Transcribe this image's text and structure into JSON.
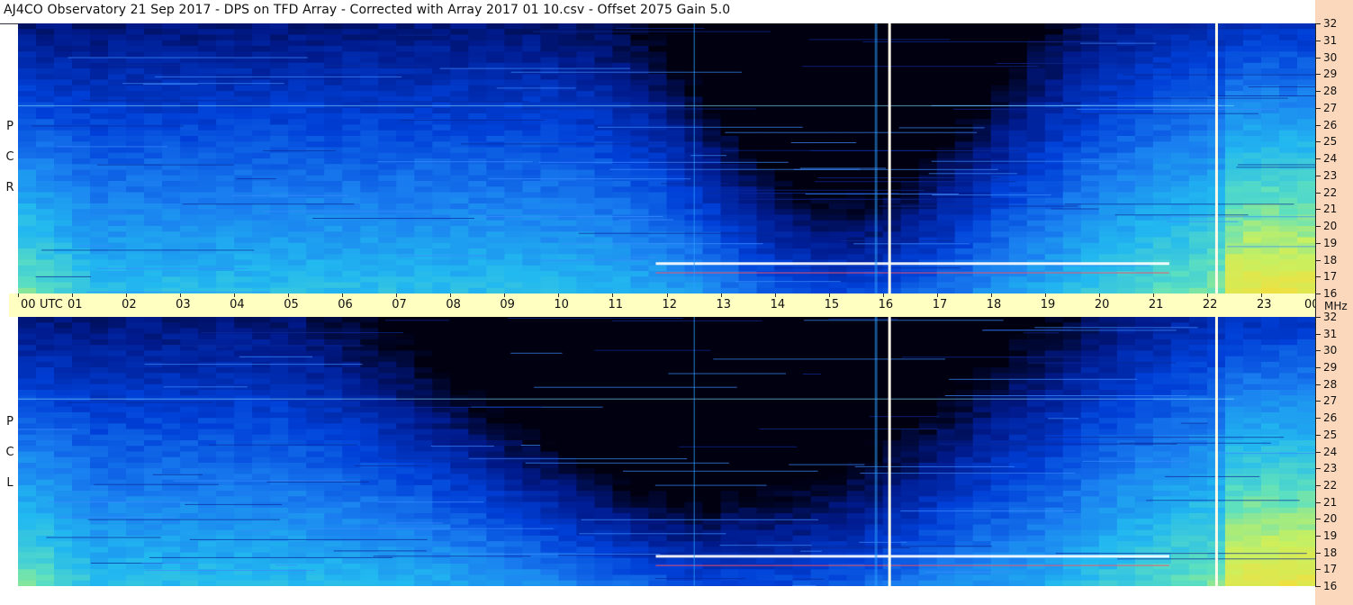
{
  "title": "AJ4CO Observatory  21 Sep 2017  -  DPS on TFD Array  -  Corrected with Array 2017 01 10.csv  -  Offset 2075  Gain 5.0",
  "panels": [
    {
      "id": "rcp",
      "label": [
        "R",
        "C",
        "P"
      ]
    },
    {
      "id": "lcp",
      "label": [
        "L",
        "C",
        "P"
      ]
    }
  ],
  "chart_data": {
    "type": "heatmap",
    "title": "AJ4CO Observatory  21 Sep 2017  -  DPS on TFD Array  -  Corrected with Array 2017 01 10.csv  -  Offset 2075  Gain 5.0",
    "x_unit_label": "UTC",
    "y_unit_label": "MHz",
    "x_ticks": [
      "00",
      "01",
      "02",
      "03",
      "04",
      "05",
      "06",
      "07",
      "08",
      "09",
      "10",
      "11",
      "12",
      "13",
      "14",
      "15",
      "16",
      "17",
      "18",
      "19",
      "20",
      "21",
      "22",
      "23",
      "00"
    ],
    "xlim_hours": [
      0,
      24
    ],
    "y_ticks": [
      32,
      31,
      30,
      29,
      28,
      27,
      26,
      25,
      24,
      23,
      22,
      21,
      20,
      19,
      18,
      17,
      16
    ],
    "ylim_mhz": [
      16,
      32
    ],
    "series": [
      {
        "name": "RCP",
        "channel": "R C P"
      },
      {
        "name": "LCP",
        "channel": "L C P"
      }
    ],
    "colormap": [
      "#000010",
      "#001a8c",
      "#0040d8",
      "#1a7ff0",
      "#22b8f0",
      "#5ce0c0",
      "#c8f060",
      "#f0e040",
      "#ffffff"
    ],
    "data_gaps_hours": [
      16.1,
      22.15
    ],
    "interference_bands_mhz": [
      17.8,
      27.1
    ]
  },
  "colors": {
    "strip_bg": "#ffffc2",
    "axis_bg": "#fbd8bc"
  }
}
